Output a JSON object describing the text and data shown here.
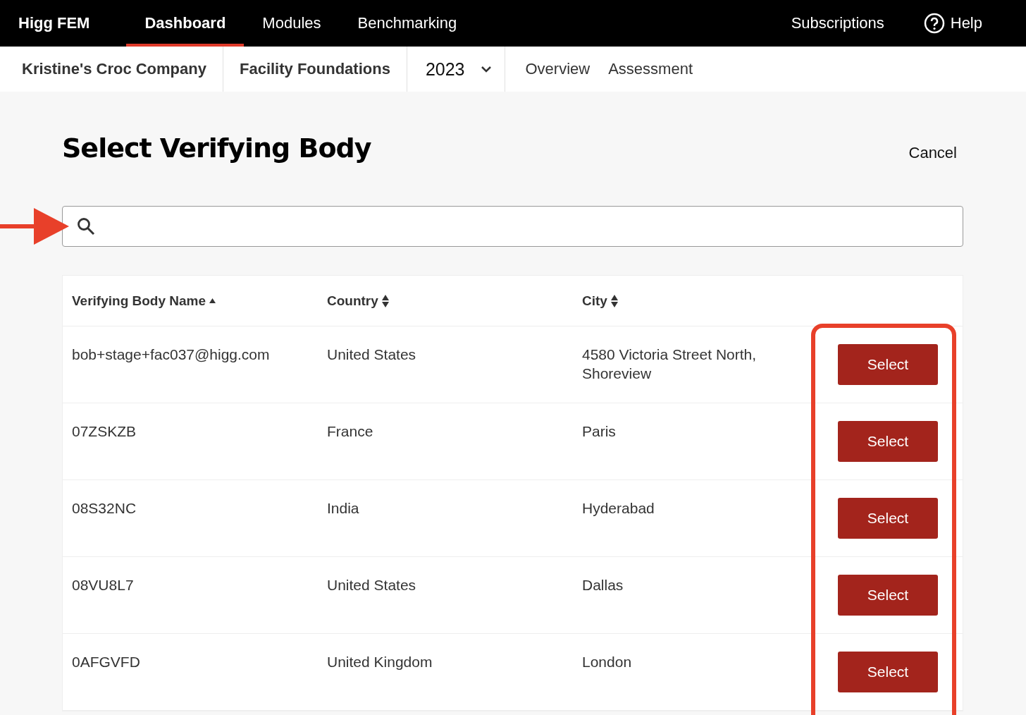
{
  "top_nav": {
    "brand": "Higg FEM",
    "tabs": [
      {
        "label": "Dashboard",
        "selected": true
      },
      {
        "label": "Modules",
        "selected": false
      },
      {
        "label": "Benchmarking",
        "selected": false
      }
    ],
    "subscriptions": "Subscriptions",
    "help": "Help"
  },
  "sub_nav": {
    "company": "Kristine's Croc Company",
    "module": "Facility Foundations",
    "year": "2023",
    "tabs": [
      "Overview",
      "Assessment"
    ]
  },
  "page": {
    "title": "Select Verifying Body",
    "cancel": "Cancel"
  },
  "table": {
    "columns": [
      {
        "label": "Verifying Body Name",
        "sorted": true
      },
      {
        "label": "Country",
        "sorted": false
      },
      {
        "label": "City",
        "sorted": false
      }
    ],
    "rows": [
      {
        "name": "bob+stage+fac037@higg.com",
        "country": "United States",
        "city": "4580 Victoria Street North, Shoreview",
        "action": "Select"
      },
      {
        "name": "07ZSKZB",
        "country": "France",
        "city": "Paris",
        "action": "Select"
      },
      {
        "name": "08S32NC",
        "country": "India",
        "city": "Hyderabad",
        "action": "Select"
      },
      {
        "name": "08VU8L7",
        "country": "United States",
        "city": "Dallas",
        "action": "Select"
      },
      {
        "name": "0AFGVFD",
        "country": "United Kingdom",
        "city": "London",
        "action": "Select"
      }
    ]
  }
}
